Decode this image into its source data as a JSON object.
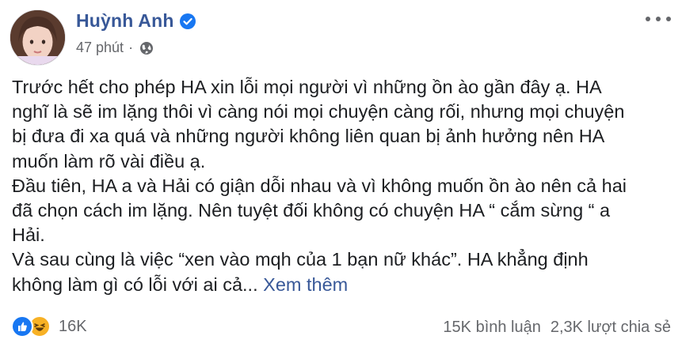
{
  "post": {
    "author": "Huỳnh Anh",
    "time": "47 phút",
    "separator": "·",
    "text_lines": [
      "Trước hết cho phép HA xin lỗi mọi người vì những ồn ào gần đây ạ. HA",
      "nghĩ là sẽ im lặng thôi vì càng nói mọi chuyện càng rối, nhưng mọi chuyện",
      "bị đưa đi xa quá và những người không liên quan bị ảnh hưởng nên HA",
      "muốn làm rõ vài điều ạ.",
      "Đầu tiên, HA a và Hải có giận dỗi nhau và vì không muốn ồn ào nên cả hai",
      "đã chọn cách im lặng. Nên tuyệt đối không có chuyện HA “ cắm sừng “ a",
      "Hải.",
      "Và sau cùng là việc “xen vào mqh của 1 bạn nữ khác”. HA khẳng định"
    ],
    "last_line": "không làm gì có lỗi với ai cả...",
    "see_more": "Xem thêm"
  },
  "footer": {
    "reaction_count": "16K",
    "comments": "15K bình luận",
    "shares": "2,3K lượt chia sẻ"
  },
  "colors": {
    "link": "#385898",
    "meta": "#65676b",
    "like": "#1877f2",
    "haha": "#f7b125"
  },
  "icons": [
    "verified-badge-icon",
    "globe-icon",
    "more-options-icon",
    "like-reaction-icon",
    "haha-reaction-icon"
  ]
}
